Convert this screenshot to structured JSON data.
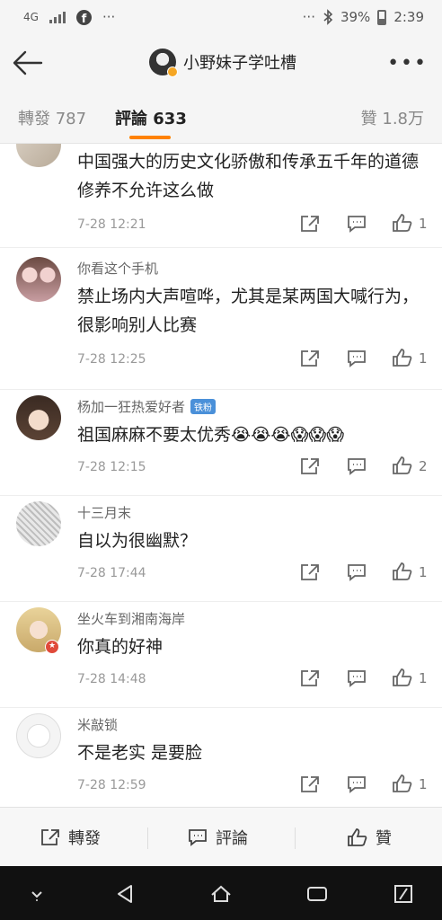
{
  "status": {
    "signal": "4G",
    "battery": "39%",
    "time": "2:39",
    "dots": "···"
  },
  "header": {
    "title": "小野妹子学吐槽",
    "more": "•••"
  },
  "tabs": {
    "repost": "轉發 787",
    "comment": "評論 633",
    "like": "贊 1.8万"
  },
  "comments": [
    {
      "text": "中国强大的历史文化骄傲和传承五千年的道德修养不允许这么做",
      "time": "7-28 12:21",
      "likes": "1"
    },
    {
      "user": "你看这个手机",
      "text": "禁止场内大声喧哗，尤其是某两国大喊行为，很影响别人比赛",
      "time": "7-28 12:25",
      "likes": "1"
    },
    {
      "user": "杨加一狂热爱好者",
      "badge": "铁粉",
      "text": "祖国麻麻不要太优秀😭😭😭😱😱😱",
      "time": "7-28 12:15",
      "likes": "2"
    },
    {
      "user": "十三月末",
      "text": "自以为很幽默？",
      "time": "7-28 17:44",
      "likes": "1"
    },
    {
      "user": "坐火车到湘南海岸",
      "text": "你真的好神",
      "time": "7-28 14:48",
      "likes": "1"
    },
    {
      "user": "米敲锁",
      "text": "不是老实 是要脸",
      "time": "7-28 12:59",
      "likes": "1"
    }
  ],
  "bottombar": {
    "repost": "轉發",
    "comment": "評論",
    "like": "贊"
  },
  "colors": {
    "accent": "#ff8200",
    "badge": "#4a90d9"
  }
}
